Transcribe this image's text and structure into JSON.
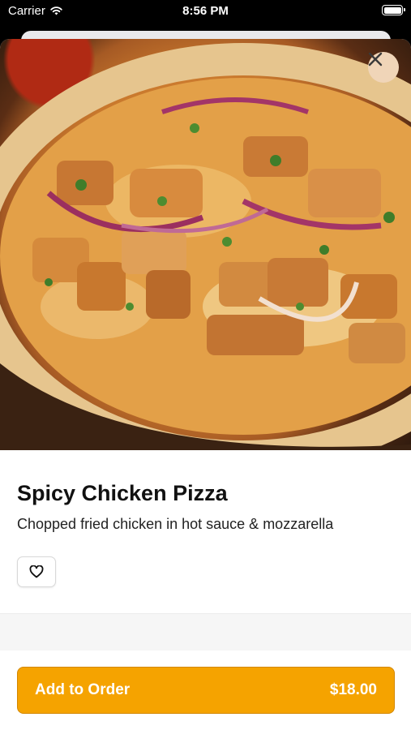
{
  "status_bar": {
    "carrier": "Carrier",
    "time": "8:56 PM"
  },
  "item": {
    "name": "Spicy Chicken Pizza",
    "description": "Chopped fried chicken in hot sauce & mozzarella",
    "image_icon": "pizza-photo"
  },
  "actions": {
    "close_icon": "close-icon",
    "favorite_icon": "heart-icon",
    "add_to_order_label": "Add to Order",
    "price": "$18.00"
  },
  "colors": {
    "accent": "#f5a300",
    "accent_border": "#d38700",
    "close_bg": "#f0d5b8"
  }
}
